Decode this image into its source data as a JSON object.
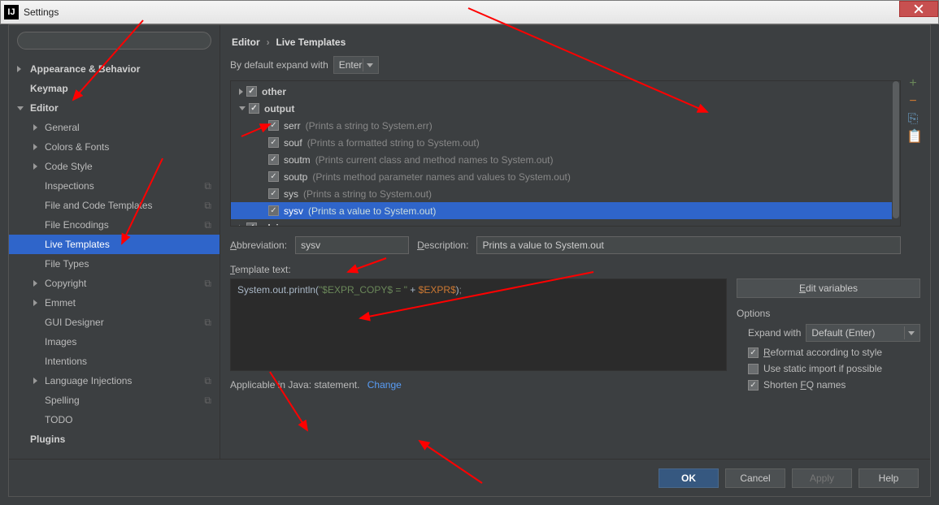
{
  "titlebar": {
    "app_icon": "IJ",
    "title": "Settings"
  },
  "sidebar": {
    "search_placeholder": "",
    "items": [
      {
        "label": "Appearance & Behavior",
        "level": 1,
        "arrow": "collapsed"
      },
      {
        "label": "Keymap",
        "level": 1
      },
      {
        "label": "Editor",
        "level": 1,
        "arrow": "expanded"
      },
      {
        "label": "General",
        "level": 2,
        "arrow": "collapsed"
      },
      {
        "label": "Colors & Fonts",
        "level": 2,
        "arrow": "collapsed"
      },
      {
        "label": "Code Style",
        "level": 2,
        "arrow": "collapsed"
      },
      {
        "label": "Inspections",
        "level": 2,
        "trail": true
      },
      {
        "label": "File and Code Templates",
        "level": 2,
        "trail": true
      },
      {
        "label": "File Encodings",
        "level": 2,
        "trail": true
      },
      {
        "label": "Live Templates",
        "level": 2,
        "selected": true
      },
      {
        "label": "File Types",
        "level": 2
      },
      {
        "label": "Copyright",
        "level": 2,
        "arrow": "collapsed",
        "trail": true
      },
      {
        "label": "Emmet",
        "level": 2,
        "arrow": "collapsed"
      },
      {
        "label": "GUI Designer",
        "level": 2,
        "trail": true
      },
      {
        "label": "Images",
        "level": 2
      },
      {
        "label": "Intentions",
        "level": 2
      },
      {
        "label": "Language Injections",
        "level": 2,
        "arrow": "collapsed",
        "trail": true
      },
      {
        "label": "Spelling",
        "level": 2,
        "trail": true
      },
      {
        "label": "TODO",
        "level": 2
      },
      {
        "label": "Plugins",
        "level": 1
      }
    ]
  },
  "breadcrumb": {
    "a": "Editor",
    "b": "Live Templates"
  },
  "expand_row": {
    "label": "By default expand with",
    "value": "Enter"
  },
  "templates": {
    "groups": [
      {
        "name": "other",
        "arrow": "collapsed",
        "checked": true
      },
      {
        "name": "output",
        "arrow": "expanded",
        "checked": true,
        "items": [
          {
            "name": "serr",
            "desc": "(Prints a string to System.err)",
            "checked": true
          },
          {
            "name": "souf",
            "desc": "(Prints a formatted string to System.out)",
            "checked": true
          },
          {
            "name": "soutm",
            "desc": "(Prints current class and method names to System.out)",
            "checked": true
          },
          {
            "name": "soutp",
            "desc": "(Prints method parameter names and values to System.out)",
            "checked": true
          },
          {
            "name": "sys",
            "desc": "(Prints a string to System.out)",
            "checked": true
          },
          {
            "name": "sysv",
            "desc": "(Prints a value to System.out)",
            "checked": true,
            "selected": true
          }
        ]
      },
      {
        "name": "plain",
        "arrow": "collapsed",
        "checked": true
      }
    ]
  },
  "fields": {
    "abbr_label": "Abbreviation:",
    "abbr_value": "sysv",
    "desc_label": "Description:",
    "desc_value": "Prints a value to System.out"
  },
  "template_text_label": "Template text:",
  "code": {
    "pre": "System.out.println",
    "paren_open": "(",
    "str1": "\"$EXPR_COPY$ = \"",
    "plus": " + ",
    "var": "$EXPR$",
    "paren_close": ")",
    "semi": ";"
  },
  "edit_vars_btn": "Edit variables",
  "options": {
    "label": "Options",
    "expand_with_label": "Expand with",
    "expand_with_value": "Default (Enter)",
    "reformat": "Reformat according to style",
    "static_import": "Use static import if possible",
    "shorten_fq": "Shorten FQ names"
  },
  "applicable": {
    "text": "Applicable in Java: statement.",
    "link": "Change"
  },
  "footer": {
    "ok": "OK",
    "cancel": "Cancel",
    "apply": "Apply",
    "help": "Help"
  }
}
